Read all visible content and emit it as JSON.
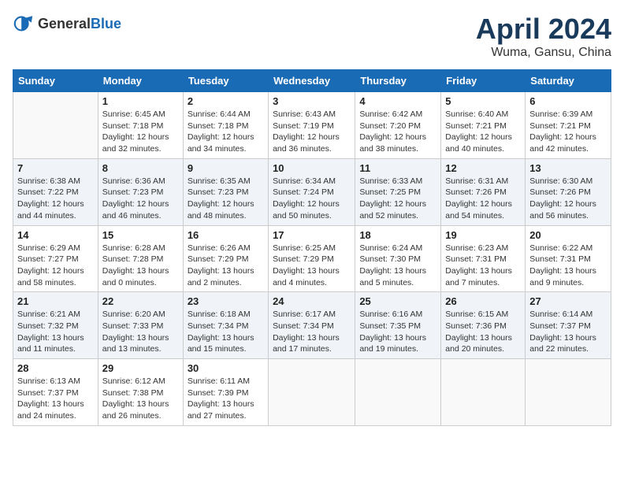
{
  "header": {
    "logo_general": "General",
    "logo_blue": "Blue",
    "month": "April 2024",
    "location": "Wuma, Gansu, China"
  },
  "days_of_week": [
    "Sunday",
    "Monday",
    "Tuesday",
    "Wednesday",
    "Thursday",
    "Friday",
    "Saturday"
  ],
  "weeks": [
    [
      {
        "day": "",
        "info": ""
      },
      {
        "day": "1",
        "info": "Sunrise: 6:45 AM\nSunset: 7:18 PM\nDaylight: 12 hours\nand 32 minutes."
      },
      {
        "day": "2",
        "info": "Sunrise: 6:44 AM\nSunset: 7:18 PM\nDaylight: 12 hours\nand 34 minutes."
      },
      {
        "day": "3",
        "info": "Sunrise: 6:43 AM\nSunset: 7:19 PM\nDaylight: 12 hours\nand 36 minutes."
      },
      {
        "day": "4",
        "info": "Sunrise: 6:42 AM\nSunset: 7:20 PM\nDaylight: 12 hours\nand 38 minutes."
      },
      {
        "day": "5",
        "info": "Sunrise: 6:40 AM\nSunset: 7:21 PM\nDaylight: 12 hours\nand 40 minutes."
      },
      {
        "day": "6",
        "info": "Sunrise: 6:39 AM\nSunset: 7:21 PM\nDaylight: 12 hours\nand 42 minutes."
      }
    ],
    [
      {
        "day": "7",
        "info": "Sunrise: 6:38 AM\nSunset: 7:22 PM\nDaylight: 12 hours\nand 44 minutes."
      },
      {
        "day": "8",
        "info": "Sunrise: 6:36 AM\nSunset: 7:23 PM\nDaylight: 12 hours\nand 46 minutes."
      },
      {
        "day": "9",
        "info": "Sunrise: 6:35 AM\nSunset: 7:23 PM\nDaylight: 12 hours\nand 48 minutes."
      },
      {
        "day": "10",
        "info": "Sunrise: 6:34 AM\nSunset: 7:24 PM\nDaylight: 12 hours\nand 50 minutes."
      },
      {
        "day": "11",
        "info": "Sunrise: 6:33 AM\nSunset: 7:25 PM\nDaylight: 12 hours\nand 52 minutes."
      },
      {
        "day": "12",
        "info": "Sunrise: 6:31 AM\nSunset: 7:26 PM\nDaylight: 12 hours\nand 54 minutes."
      },
      {
        "day": "13",
        "info": "Sunrise: 6:30 AM\nSunset: 7:26 PM\nDaylight: 12 hours\nand 56 minutes."
      }
    ],
    [
      {
        "day": "14",
        "info": "Sunrise: 6:29 AM\nSunset: 7:27 PM\nDaylight: 12 hours\nand 58 minutes."
      },
      {
        "day": "15",
        "info": "Sunrise: 6:28 AM\nSunset: 7:28 PM\nDaylight: 13 hours\nand 0 minutes."
      },
      {
        "day": "16",
        "info": "Sunrise: 6:26 AM\nSunset: 7:29 PM\nDaylight: 13 hours\nand 2 minutes."
      },
      {
        "day": "17",
        "info": "Sunrise: 6:25 AM\nSunset: 7:29 PM\nDaylight: 13 hours\nand 4 minutes."
      },
      {
        "day": "18",
        "info": "Sunrise: 6:24 AM\nSunset: 7:30 PM\nDaylight: 13 hours\nand 5 minutes."
      },
      {
        "day": "19",
        "info": "Sunrise: 6:23 AM\nSunset: 7:31 PM\nDaylight: 13 hours\nand 7 minutes."
      },
      {
        "day": "20",
        "info": "Sunrise: 6:22 AM\nSunset: 7:31 PM\nDaylight: 13 hours\nand 9 minutes."
      }
    ],
    [
      {
        "day": "21",
        "info": "Sunrise: 6:21 AM\nSunset: 7:32 PM\nDaylight: 13 hours\nand 11 minutes."
      },
      {
        "day": "22",
        "info": "Sunrise: 6:20 AM\nSunset: 7:33 PM\nDaylight: 13 hours\nand 13 minutes."
      },
      {
        "day": "23",
        "info": "Sunrise: 6:18 AM\nSunset: 7:34 PM\nDaylight: 13 hours\nand 15 minutes."
      },
      {
        "day": "24",
        "info": "Sunrise: 6:17 AM\nSunset: 7:34 PM\nDaylight: 13 hours\nand 17 minutes."
      },
      {
        "day": "25",
        "info": "Sunrise: 6:16 AM\nSunset: 7:35 PM\nDaylight: 13 hours\nand 19 minutes."
      },
      {
        "day": "26",
        "info": "Sunrise: 6:15 AM\nSunset: 7:36 PM\nDaylight: 13 hours\nand 20 minutes."
      },
      {
        "day": "27",
        "info": "Sunrise: 6:14 AM\nSunset: 7:37 PM\nDaylight: 13 hours\nand 22 minutes."
      }
    ],
    [
      {
        "day": "28",
        "info": "Sunrise: 6:13 AM\nSunset: 7:37 PM\nDaylight: 13 hours\nand 24 minutes."
      },
      {
        "day": "29",
        "info": "Sunrise: 6:12 AM\nSunset: 7:38 PM\nDaylight: 13 hours\nand 26 minutes."
      },
      {
        "day": "30",
        "info": "Sunrise: 6:11 AM\nSunset: 7:39 PM\nDaylight: 13 hours\nand 27 minutes."
      },
      {
        "day": "",
        "info": ""
      },
      {
        "day": "",
        "info": ""
      },
      {
        "day": "",
        "info": ""
      },
      {
        "day": "",
        "info": ""
      }
    ]
  ]
}
